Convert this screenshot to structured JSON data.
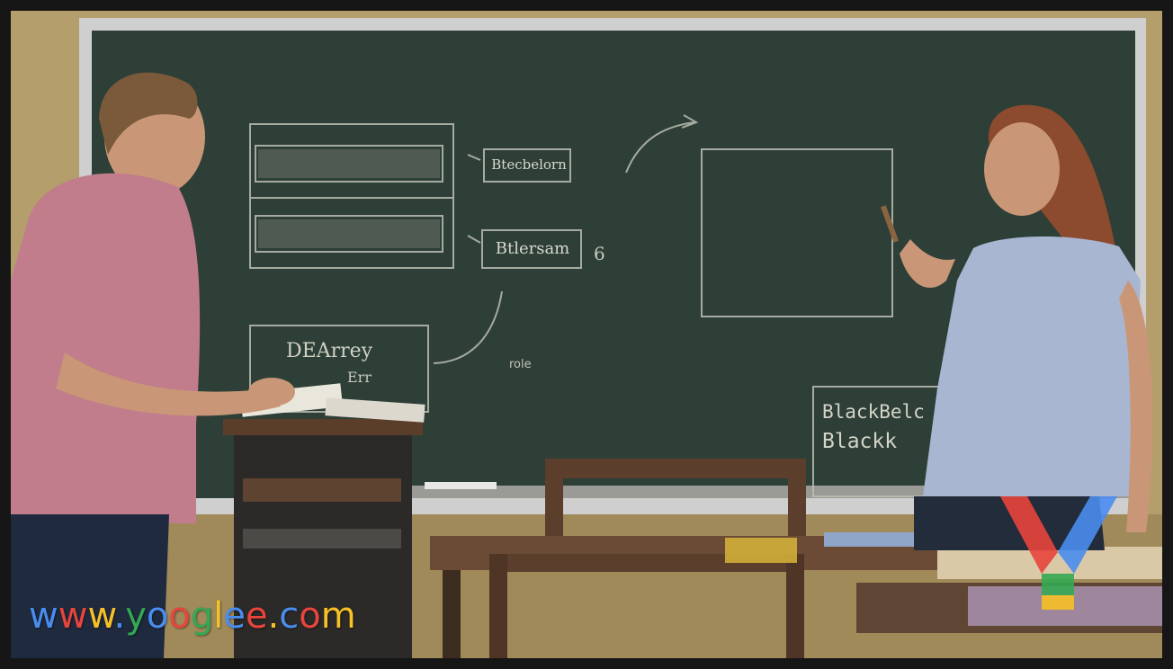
{
  "image": {
    "description_free": true
  },
  "chalkboard": {
    "label_box_1": "Btecbelorn",
    "label_box_2": "Btlersam",
    "label_box_2_suffix": "6",
    "label_box_3_line1": "DEArrey",
    "label_box_3_line2": "Err",
    "note": "role",
    "corner_line1": "BlackBelc",
    "corner_line2": "Blackk"
  },
  "watermark": {
    "parts": [
      {
        "text": "w",
        "color": "#4a8df0"
      },
      {
        "text": "w",
        "color": "#e8453c"
      },
      {
        "text": "w",
        "color": "#f6c026"
      },
      {
        "text": ".",
        "color": "#4a8df0"
      },
      {
        "text": "y",
        "color": "#34a853"
      },
      {
        "text": "o",
        "color": "#4a8df0"
      },
      {
        "text": "o",
        "color": "#e8453c"
      },
      {
        "text": "g",
        "color": "#34a853"
      },
      {
        "text": "l",
        "color": "#f6c026"
      },
      {
        "text": "e",
        "color": "#4a8df0"
      },
      {
        "text": "e",
        "color": "#e8453c"
      },
      {
        "text": ".",
        "color": "#f6c026"
      },
      {
        "text": "c",
        "color": "#4a8df0"
      },
      {
        "text": "o",
        "color": "#e8453c"
      },
      {
        "text": "m",
        "color": "#f6c026"
      }
    ]
  },
  "logo": {
    "name": "y-logo-icon",
    "colors": [
      "#e8453c",
      "#4a8df0",
      "#34a853",
      "#f6c026"
    ]
  }
}
